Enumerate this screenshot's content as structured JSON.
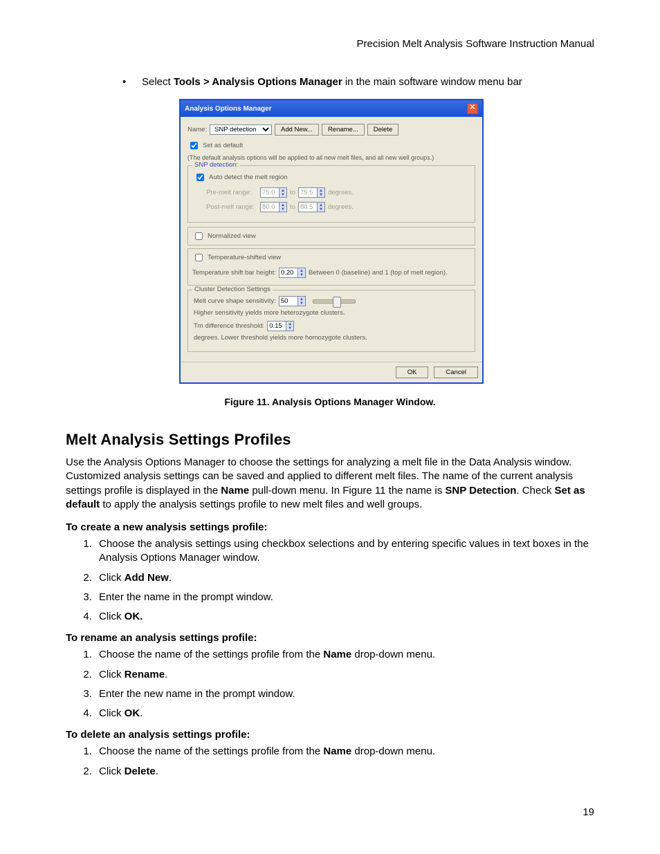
{
  "header": "Precision Melt Analysis Software Instruction Manual",
  "bullet": {
    "pre": "Select ",
    "bold": "Tools > Analysis Options Manager",
    "post": " in the main software window menu bar"
  },
  "dialog": {
    "title": "Analysis Options Manager",
    "name_label": "Name:",
    "name_value": "SNP detection",
    "add_new": "Add New...",
    "rename": "Rename...",
    "delete": "Delete",
    "set_default_label": "Set as default",
    "set_default_note": "(The default analysis options will be applied to all new melt files, and all new well groups.)",
    "snp_group_title": "SNP detection:",
    "auto_detect": "Auto detect the melt region",
    "pre_melt_label": "Pre-melt range:",
    "pre_melt_a": "75.0",
    "to": "to",
    "pre_melt_b": "75.5",
    "degrees": "degrees.",
    "post_melt_label": "Post-melt range:",
    "post_melt_a": "80.0",
    "post_melt_b": "80.5",
    "normalized": "Normalized view",
    "temp_shifted": "Temperature-shifted view",
    "shift_label": "Temperature shift bar height:",
    "shift_value": "0.20",
    "shift_note": "Between 0 (baseline) and 1 (top of melt region).",
    "cluster_title": "Cluster Detection Settings",
    "sens_label": "Melt curve shape sensitivity:",
    "sens_value": "50",
    "sens_note": "Higher sensitivity yields more heterozygote clusters.",
    "tm_label": "Tm difference threshold:",
    "tm_value": "0.15",
    "tm_note": "degrees.  Lower threshold yields more homozygote clusters.",
    "ok": "OK",
    "cancel": "Cancel"
  },
  "caption": "Figure 11. Analysis Options Manager Window.",
  "section_heading": "Melt Analysis Settings Profiles",
  "para": {
    "p1a": "Use the Analysis Options Manager to choose the settings for analyzing a melt file in the Data Analysis window. Customized analysis settings can be saved and applied to different melt files. The name of the current analysis settings profile is displayed in the ",
    "p1b": "Name",
    "p1c": " pull-down menu. In Figure 11 the name is ",
    "p1d": "SNP Detection",
    "p1e": ". Check ",
    "p1f": "Set as default",
    "p1g": " to apply the analysis settings profile to new melt files and well groups."
  },
  "create": {
    "title": "To create a new analysis settings profile:",
    "s1": "Choose the analysis settings using checkbox selections and by entering specific values in text boxes in the Analysis Options Manager window.",
    "s2a": "Click ",
    "s2b": "Add New",
    "s2c": ".",
    "s3": "Enter the name in the prompt window.",
    "s4a": "Click ",
    "s4b": "OK."
  },
  "rename": {
    "title": "To rename an analysis settings profile:",
    "s1a": "Choose the name of the settings profile from the ",
    "s1b": "Name",
    "s1c": " drop-down menu.",
    "s2a": "Click ",
    "s2b": "Rename",
    "s2c": ".",
    "s3": "Enter the new name in the prompt window.",
    "s4a": "Click ",
    "s4b": "OK",
    "s4c": "."
  },
  "delete": {
    "title": "To delete an analysis settings profile:",
    "s1a": "Choose the name of the settings profile from the ",
    "s1b": "Name",
    "s1c": " drop-down menu.",
    "s2a": "Click ",
    "s2b": "Delete",
    "s2c": "."
  },
  "pagenum": "19"
}
